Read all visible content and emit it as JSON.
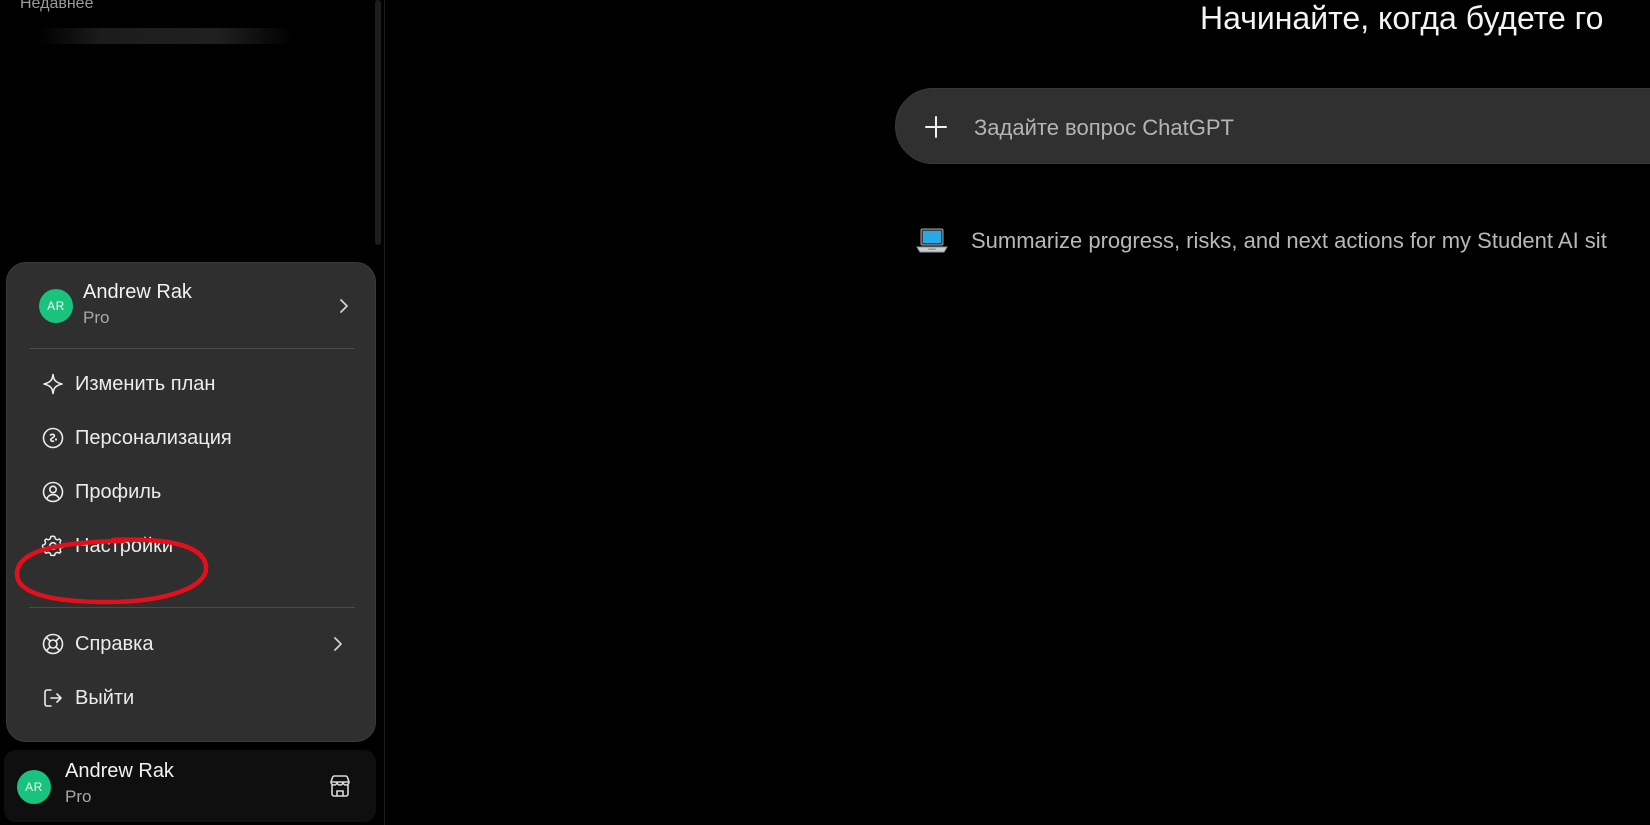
{
  "sidebar": {
    "recent_heading": "Недавнее"
  },
  "account_menu": {
    "user": {
      "initials": "AR",
      "name": "Andrew Rak",
      "plan": "Pro"
    },
    "items": [
      {
        "label": "Изменить план",
        "icon": "sparkle-icon"
      },
      {
        "label": "Персонализация",
        "icon": "personalization-icon"
      },
      {
        "label": "Профиль",
        "icon": "profile-icon"
      },
      {
        "label": "Настройки",
        "icon": "gear-icon",
        "annotated": true
      },
      {
        "label": "Справка",
        "icon": "lifebuoy-icon",
        "has_submenu": true
      },
      {
        "label": "Выйти",
        "icon": "logout-icon"
      }
    ]
  },
  "account_bar": {
    "initials": "AR",
    "name": "Andrew Rak",
    "plan": "Pro",
    "icon": "shop-icon"
  },
  "main": {
    "greeting": "Начинайте, когда будете го",
    "composer": {
      "placeholder": "Задайте вопрос ChatGPT",
      "value": ""
    },
    "suggestion": {
      "emoji": "laptop-icon",
      "text": "Summarize progress, risks, and next actions for my Student AI sit"
    }
  },
  "colors": {
    "background": "#000000",
    "menu_background": "#2f2f2f",
    "composer_background": "#303030",
    "avatar": "#19c37d",
    "annotation": "#e3101b"
  }
}
